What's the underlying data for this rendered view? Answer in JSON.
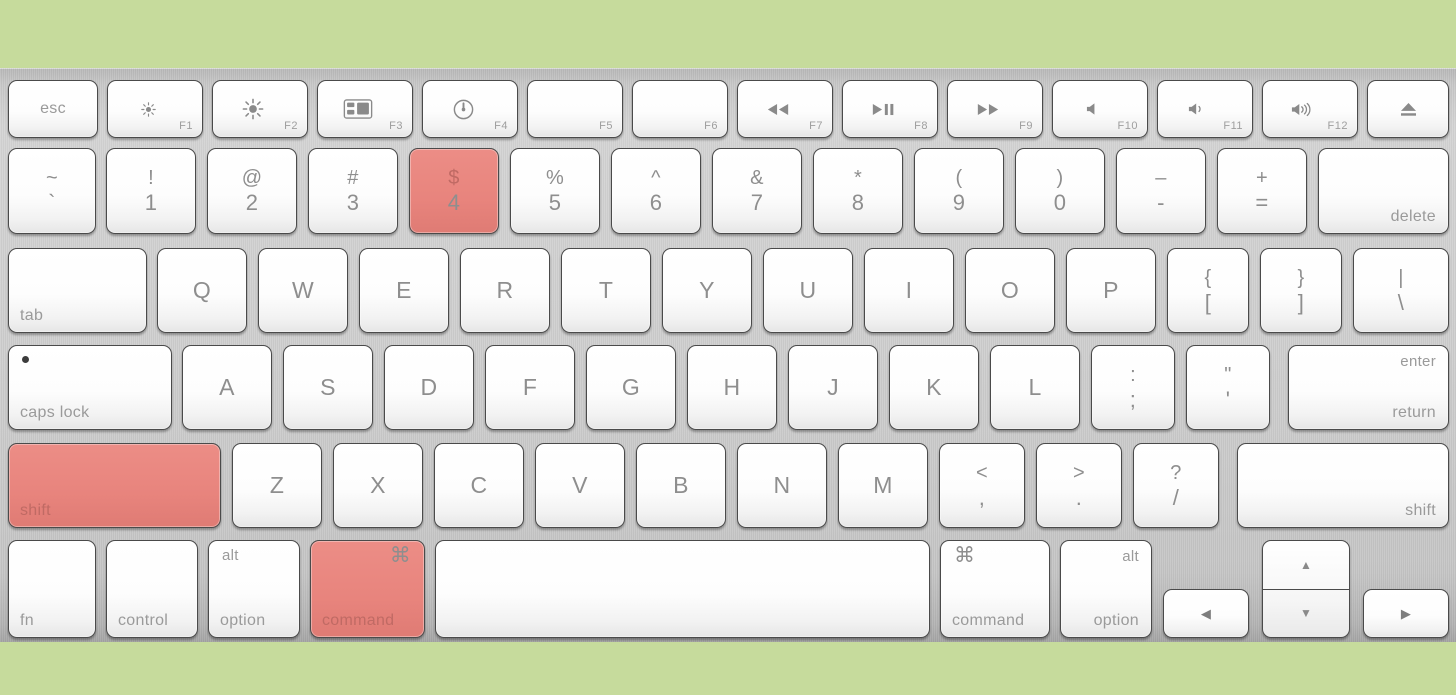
{
  "scene": {
    "title": "Apple Wireless Keyboard with highlighted shortcut keys",
    "background_color": "#c6db9c",
    "body_color": "#cfcfcf",
    "key_color": "#ffffff",
    "highlight_color": "#e8847d",
    "label_color": "#8e8e8e",
    "highlighted_keys": [
      "shift",
      "command",
      "4"
    ]
  },
  "rows": {
    "function_row": [
      {
        "name": "esc",
        "label": "esc",
        "icon": "",
        "fn": ""
      },
      {
        "name": "f1",
        "label": "",
        "icon": "brightness-down-icon",
        "fn": "F1"
      },
      {
        "name": "f2",
        "label": "",
        "icon": "brightness-up-icon",
        "fn": "F2"
      },
      {
        "name": "f3",
        "label": "",
        "icon": "mission-control-icon",
        "fn": "F3"
      },
      {
        "name": "f4",
        "label": "",
        "icon": "dashboard-icon",
        "fn": "F4"
      },
      {
        "name": "f5",
        "label": "",
        "icon": "",
        "fn": "F5"
      },
      {
        "name": "f6",
        "label": "",
        "icon": "",
        "fn": "F6"
      },
      {
        "name": "f7",
        "label": "",
        "icon": "rewind-icon",
        "fn": "F7"
      },
      {
        "name": "f8",
        "label": "",
        "icon": "play-pause-icon",
        "fn": "F8"
      },
      {
        "name": "f9",
        "label": "",
        "icon": "fast-forward-icon",
        "fn": "F9"
      },
      {
        "name": "f10",
        "label": "",
        "icon": "mute-icon",
        "fn": "F10"
      },
      {
        "name": "f11",
        "label": "",
        "icon": "volume-down-icon",
        "fn": "F11"
      },
      {
        "name": "f12",
        "label": "",
        "icon": "volume-up-icon",
        "fn": "F12"
      },
      {
        "name": "eject",
        "label": "",
        "icon": "eject-icon",
        "fn": ""
      }
    ],
    "number_row": [
      {
        "name": "backtick",
        "top": "~",
        "bottom": "`",
        "highlight": false
      },
      {
        "name": "one",
        "top": "!",
        "bottom": "1",
        "highlight": false
      },
      {
        "name": "two",
        "top": "@",
        "bottom": "2",
        "highlight": false
      },
      {
        "name": "three",
        "top": "#",
        "bottom": "3",
        "highlight": false
      },
      {
        "name": "four",
        "top": "$",
        "bottom": "4",
        "highlight": true
      },
      {
        "name": "five",
        "top": "%",
        "bottom": "5",
        "highlight": false
      },
      {
        "name": "six",
        "top": "^",
        "bottom": "6",
        "highlight": false
      },
      {
        "name": "seven",
        "top": "&",
        "bottom": "7",
        "highlight": false
      },
      {
        "name": "eight",
        "top": "*",
        "bottom": "8",
        "highlight": false
      },
      {
        "name": "nine",
        "top": "(",
        "bottom": "9",
        "highlight": false
      },
      {
        "name": "zero",
        "top": ")",
        "bottom": "0",
        "highlight": false
      },
      {
        "name": "minus",
        "top": "–",
        "bottom": "-",
        "highlight": false
      },
      {
        "name": "equals",
        "top": "+",
        "bottom": "=",
        "highlight": false
      }
    ],
    "number_row_delete": "delete",
    "qwerty_row_tab": "tab",
    "qwerty_row": [
      {
        "name": "q",
        "label": "Q"
      },
      {
        "name": "w",
        "label": "W"
      },
      {
        "name": "e",
        "label": "E"
      },
      {
        "name": "r",
        "label": "R"
      },
      {
        "name": "t",
        "label": "T"
      },
      {
        "name": "y",
        "label": "Y"
      },
      {
        "name": "u",
        "label": "U"
      },
      {
        "name": "i",
        "label": "I"
      },
      {
        "name": "o",
        "label": "O"
      },
      {
        "name": "p",
        "label": "P"
      }
    ],
    "qwerty_row_brackets": [
      {
        "name": "left-bracket",
        "top": "{",
        "bottom": "["
      },
      {
        "name": "right-bracket",
        "top": "}",
        "bottom": "]"
      },
      {
        "name": "backslash",
        "top": "|",
        "bottom": "\\"
      }
    ],
    "home_row_capslock": "caps lock",
    "home_row": [
      {
        "name": "a",
        "label": "A"
      },
      {
        "name": "s",
        "label": "S"
      },
      {
        "name": "d",
        "label": "D"
      },
      {
        "name": "f",
        "label": "F"
      },
      {
        "name": "g",
        "label": "G"
      },
      {
        "name": "h",
        "label": "H"
      },
      {
        "name": "j",
        "label": "J"
      },
      {
        "name": "k",
        "label": "K"
      },
      {
        "name": "l",
        "label": "L"
      }
    ],
    "home_row_punct": [
      {
        "name": "semicolon",
        "top": ":",
        "bottom": ";"
      },
      {
        "name": "quote",
        "top": "\"",
        "bottom": "'"
      }
    ],
    "home_row_return": {
      "enter": "enter",
      "return": "return"
    },
    "shift_row_left": "shift",
    "shift_row": [
      {
        "name": "z",
        "label": "Z"
      },
      {
        "name": "x",
        "label": "X"
      },
      {
        "name": "c",
        "label": "C"
      },
      {
        "name": "v",
        "label": "V"
      },
      {
        "name": "b",
        "label": "B"
      },
      {
        "name": "n",
        "label": "N"
      },
      {
        "name": "m",
        "label": "M"
      }
    ],
    "shift_row_punct": [
      {
        "name": "comma",
        "top": "<",
        "bottom": ","
      },
      {
        "name": "period",
        "top": ">",
        "bottom": "."
      },
      {
        "name": "slash",
        "top": "?",
        "bottom": "/"
      }
    ],
    "shift_row_right": "shift",
    "bottom_row": {
      "fn": "fn",
      "control": "control",
      "option_left": {
        "alt": "alt",
        "option": "option"
      },
      "command_left": {
        "symbol": "⌘",
        "label": "command"
      },
      "space": "",
      "command_right": {
        "symbol": "⌘",
        "label": "command"
      },
      "option_right": {
        "alt": "alt",
        "option": "option"
      },
      "arrow_left": "◀",
      "arrow_up": "▲",
      "arrow_down": "▼",
      "arrow_right": "▶"
    }
  }
}
